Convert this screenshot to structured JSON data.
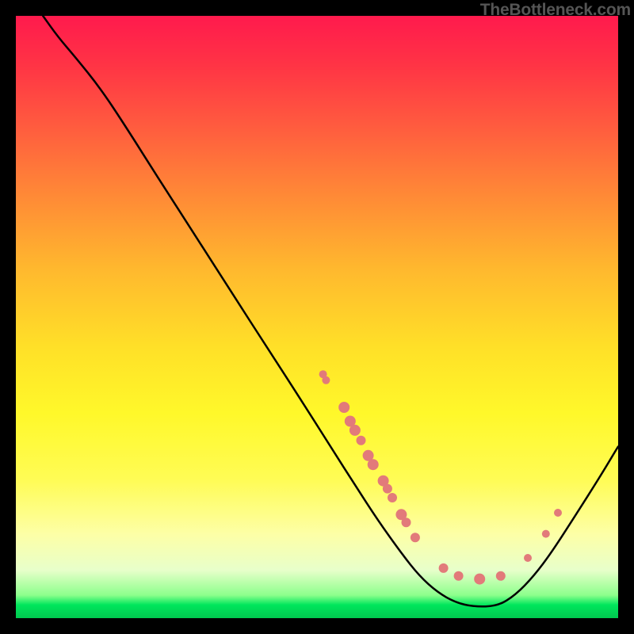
{
  "watermark": "TheBottleneck.com",
  "chart_data": {
    "type": "line",
    "title": "",
    "xlabel": "",
    "ylabel": "",
    "xlim": [
      0,
      100
    ],
    "ylim": [
      0,
      100
    ],
    "grid": false,
    "legend": false,
    "series": [
      {
        "name": "curve",
        "type": "line",
        "color": "#000000",
        "points": [
          {
            "x": 4.5,
            "y": 100
          },
          {
            "x": 7,
            "y": 96.5
          },
          {
            "x": 10,
            "y": 93
          },
          {
            "x": 14,
            "y": 88
          },
          {
            "x": 18,
            "y": 82
          },
          {
            "x": 24,
            "y": 72.5
          },
          {
            "x": 30,
            "y": 63.2
          },
          {
            "x": 36,
            "y": 53.8
          },
          {
            "x": 42,
            "y": 44.5
          },
          {
            "x": 48,
            "y": 35.2
          },
          {
            "x": 53,
            "y": 27.3
          },
          {
            "x": 56,
            "y": 22.6
          },
          {
            "x": 60,
            "y": 16.4
          },
          {
            "x": 64,
            "y": 10.8
          },
          {
            "x": 67,
            "y": 7.0
          },
          {
            "x": 70,
            "y": 4.3
          },
          {
            "x": 73,
            "y": 2.6
          },
          {
            "x": 76,
            "y": 1.9
          },
          {
            "x": 80,
            "y": 2.0
          },
          {
            "x": 83,
            "y": 3.9
          },
          {
            "x": 86,
            "y": 7.0
          },
          {
            "x": 89,
            "y": 11.0
          },
          {
            "x": 93,
            "y": 17.2
          },
          {
            "x": 97,
            "y": 23.5
          },
          {
            "x": 100,
            "y": 28.5
          }
        ]
      },
      {
        "name": "dots",
        "type": "scatter",
        "color": "#e27a7a",
        "points": [
          {
            "x": 51.0,
            "y": 40.5,
            "r": 5
          },
          {
            "x": 51.5,
            "y": 39.5,
            "r": 5
          },
          {
            "x": 54.5,
            "y": 35.0,
            "r": 7
          },
          {
            "x": 55.5,
            "y": 32.7,
            "r": 7
          },
          {
            "x": 56.3,
            "y": 31.2,
            "r": 7
          },
          {
            "x": 57.3,
            "y": 29.5,
            "r": 6
          },
          {
            "x": 58.5,
            "y": 27.0,
            "r": 7
          },
          {
            "x": 59.3,
            "y": 25.5,
            "r": 7
          },
          {
            "x": 61.0,
            "y": 22.8,
            "r": 7
          },
          {
            "x": 61.7,
            "y": 21.5,
            "r": 6
          },
          {
            "x": 62.5,
            "y": 20.0,
            "r": 6
          },
          {
            "x": 64.0,
            "y": 17.2,
            "r": 7
          },
          {
            "x": 64.8,
            "y": 15.9,
            "r": 6
          },
          {
            "x": 66.3,
            "y": 13.4,
            "r": 6
          },
          {
            "x": 71.0,
            "y": 8.3,
            "r": 6
          },
          {
            "x": 73.5,
            "y": 7.0,
            "r": 6
          },
          {
            "x": 77.0,
            "y": 6.5,
            "r": 7
          },
          {
            "x": 80.5,
            "y": 7.0,
            "r": 6
          },
          {
            "x": 85.0,
            "y": 10.0,
            "r": 5
          },
          {
            "x": 88.0,
            "y": 14.0,
            "r": 5
          },
          {
            "x": 90.0,
            "y": 17.5,
            "r": 5
          }
        ]
      }
    ]
  }
}
